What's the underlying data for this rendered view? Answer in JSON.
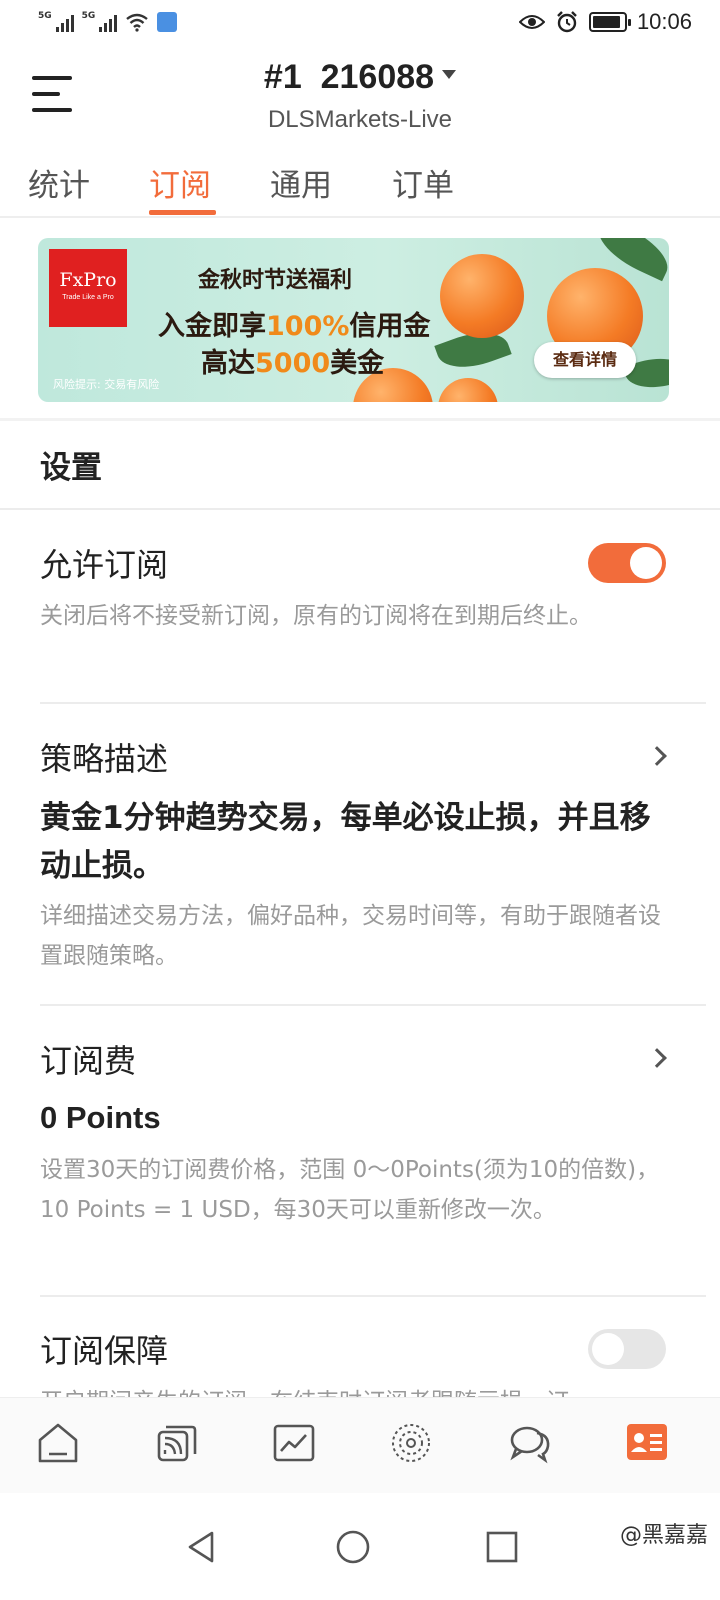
{
  "status_bar": {
    "time": "10:06",
    "signal_1_label": "5G",
    "signal_2_label": "5G",
    "icons": [
      "sim-signal-icon",
      "sim-signal-icon",
      "wifi-icon",
      "app-notification-icon",
      "eye-icon",
      "alarm-icon",
      "battery-icon"
    ],
    "battery_level": 0.9
  },
  "header": {
    "account": "#1  216088",
    "server": "DLSMarkets-Live",
    "menu_icon": "hamburger-menu-icon"
  },
  "tabs": [
    {
      "label": "统计",
      "active": false
    },
    {
      "label": "订阅",
      "active": true
    },
    {
      "label": "通用",
      "active": false
    },
    {
      "label": "订单",
      "active": false
    }
  ],
  "banner": {
    "logo": "FxPro",
    "logo_tagline": "Trade Like a Pro",
    "line1": "金秋时节送福利",
    "line2_a": "入金即享",
    "line2_b": "100%",
    "line2_c": "信用金",
    "line3_a": "高达",
    "line3_b": "5000",
    "line3_c": "美金",
    "risk_note": "风险提示: 交易有风险",
    "cta": "查看详情"
  },
  "settings": {
    "section_title": "设置",
    "allow_subscription": {
      "title": "允许订阅",
      "enabled": true,
      "description": "关闭后将不接受新订阅，原有的订阅将在到期后终止。"
    },
    "strategy": {
      "title": "策略描述",
      "value": "黄金1分钟趋势交易，每单必设止损，并且移动止损。",
      "description": "详细描述交易方法，偏好品种，交易时间等，有助于跟随者设置跟随策略。"
    },
    "fee": {
      "title": "订阅费",
      "value": "0 Points",
      "description": "设置30天的订阅费价格，范围 0～0Points(须为10的倍数)，10 Points = 1 USD，每30天可以重新修改一次。"
    },
    "guarantee": {
      "title": "订阅保障",
      "enabled": false,
      "description_partial": "开启期间产生的订阅，在结束时订阅者跟随亏损，订"
    }
  },
  "bottom_nav": [
    {
      "icon": "home-icon",
      "active": false
    },
    {
      "icon": "quotes-cards-icon",
      "active": false
    },
    {
      "icon": "chart-icon",
      "active": false
    },
    {
      "icon": "community-globe-icon",
      "active": false
    },
    {
      "icon": "chat-icon",
      "active": false
    },
    {
      "icon": "profile-card-icon",
      "active": true
    }
  ],
  "accent_color": "#f26c3b",
  "system_nav": {
    "icons": [
      "back-icon",
      "home-circle-icon",
      "recents-icon"
    ],
    "watermark": "@黑嘉嘉"
  }
}
